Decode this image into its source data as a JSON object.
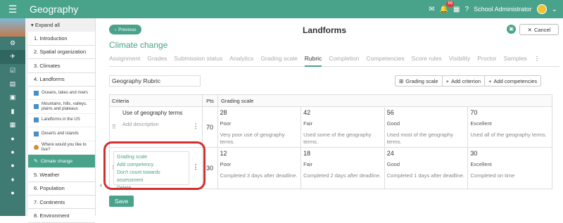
{
  "app": {
    "title": "Geography",
    "badge_count": "66",
    "user_name": "School Administrator"
  },
  "sidebar": {
    "expand_all": "Expand all",
    "items": [
      {
        "label": "1. Introduction"
      },
      {
        "label": "2. Spatial organization"
      },
      {
        "label": "3. Climates"
      },
      {
        "label": "4. Landforms"
      }
    ],
    "subitems": [
      {
        "label": "Oceans, lakes and rivers"
      },
      {
        "label": "Mountains, hills, valleys, plains and plateaus"
      },
      {
        "label": "Landforms in the US"
      },
      {
        "label": "Deserts and islands"
      },
      {
        "label": "Where would you like to live?"
      },
      {
        "label": "Climate change"
      }
    ],
    "items_after": [
      {
        "label": "5. Weather"
      },
      {
        "label": "6. Population"
      },
      {
        "label": "7. Continents"
      },
      {
        "label": "8. Environment"
      }
    ]
  },
  "header": {
    "previous_label": "Previous",
    "page_title": "Landforms",
    "cancel_label": "Cancel",
    "subtitle": "Climate change"
  },
  "tabs": [
    "Assignment",
    "Grades",
    "Submission status",
    "Analytics",
    "Grading scale",
    "Rubric",
    "Completion",
    "Competencies",
    "Score rules",
    "Visibility",
    "Proctor",
    "Samples"
  ],
  "active_tab": "Rubric",
  "rubric": {
    "name": "Geography Rubric",
    "actions": {
      "grading_scale": "Grading scale",
      "add_criterion": "Add criterion",
      "add_competencies": "Add competencies"
    },
    "headers": {
      "criteria": "Criteria",
      "pts": "Pts",
      "grading_scale": "Grading scale"
    },
    "rows": [
      {
        "criterion": "Use of geography terms",
        "description_placeholder": "Add description",
        "pts": "70",
        "levels": [
          {
            "points": "28",
            "title": "Poor",
            "desc": "Very poor use of geography terms."
          },
          {
            "points": "42",
            "title": "Fair",
            "desc": "Used some of the geography terms."
          },
          {
            "points": "56",
            "title": "Good",
            "desc": "Used most of the geography terms."
          },
          {
            "points": "70",
            "title": "Excellent",
            "desc": "Used all of the geography terms."
          }
        ]
      },
      {
        "criterion": "",
        "description_placeholder": "",
        "pts": "30",
        "levels": [
          {
            "points": "12",
            "title": "Poor",
            "desc": "Completed 3 days after deadline."
          },
          {
            "points": "18",
            "title": "Fair",
            "desc": "Completed 2 days after deadline."
          },
          {
            "points": "24",
            "title": "Good",
            "desc": "Completed 1 days after deadline."
          },
          {
            "points": "30",
            "title": "Excellent",
            "desc": "Completed on time"
          }
        ]
      }
    ],
    "context_menu": [
      "Grading scale",
      "Add competency",
      "Don't count towards assessment",
      "Delete"
    ]
  },
  "save_label": "Save"
}
